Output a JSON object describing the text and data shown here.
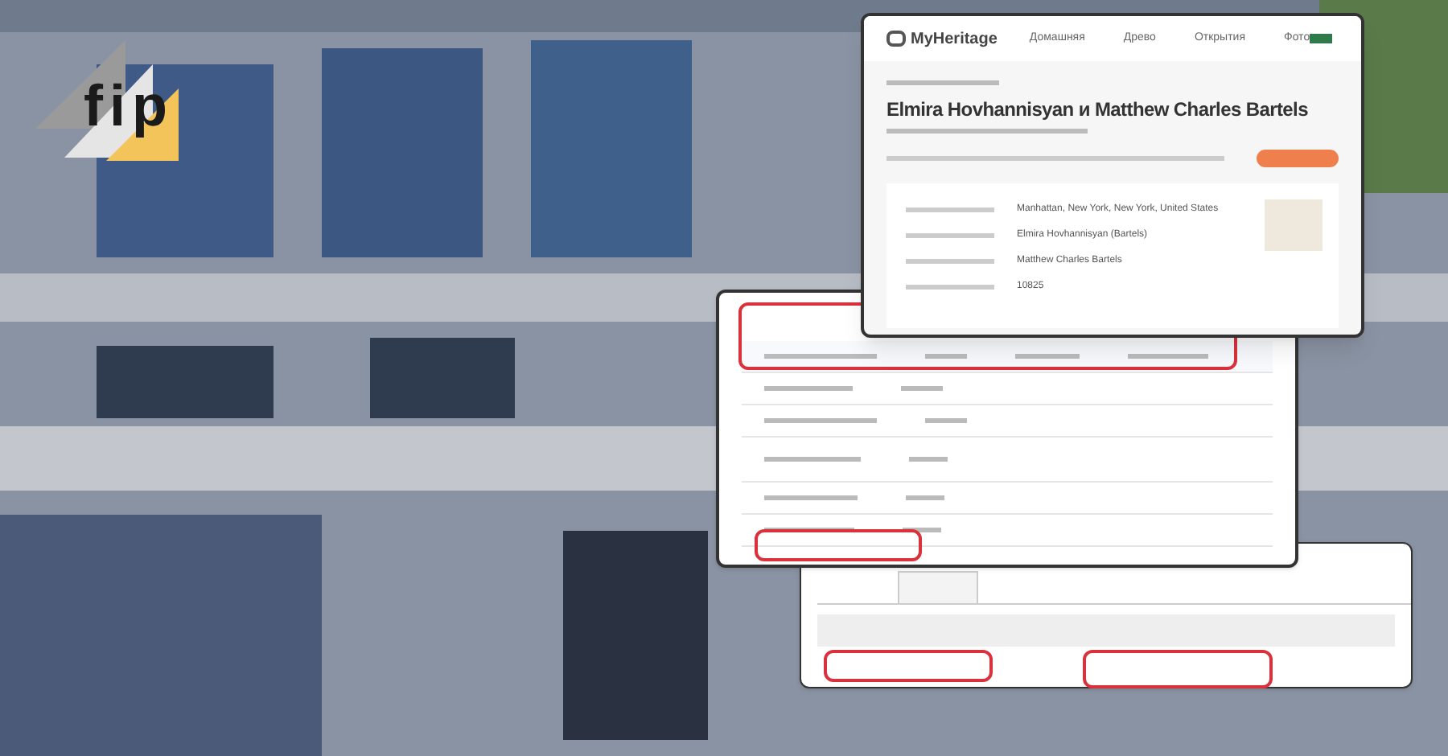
{
  "logo": {
    "text": "fip"
  },
  "record_card": {
    "brand": "MyHeritage",
    "nav": [
      {
        "label": "Домашняя"
      },
      {
        "label": "Древо"
      },
      {
        "label": "Открытия"
      },
      {
        "label": "Фото"
      }
    ],
    "title": "Elmira Hovhannisyan и Matthew Charles Bartels",
    "fields": [
      {
        "value": "Manhattan, New York, New York, United States"
      },
      {
        "value": "Elmira Hovhannisyan (Bartels)"
      },
      {
        "value": "Matthew Charles Bartels"
      },
      {
        "value": "10825"
      }
    ]
  }
}
